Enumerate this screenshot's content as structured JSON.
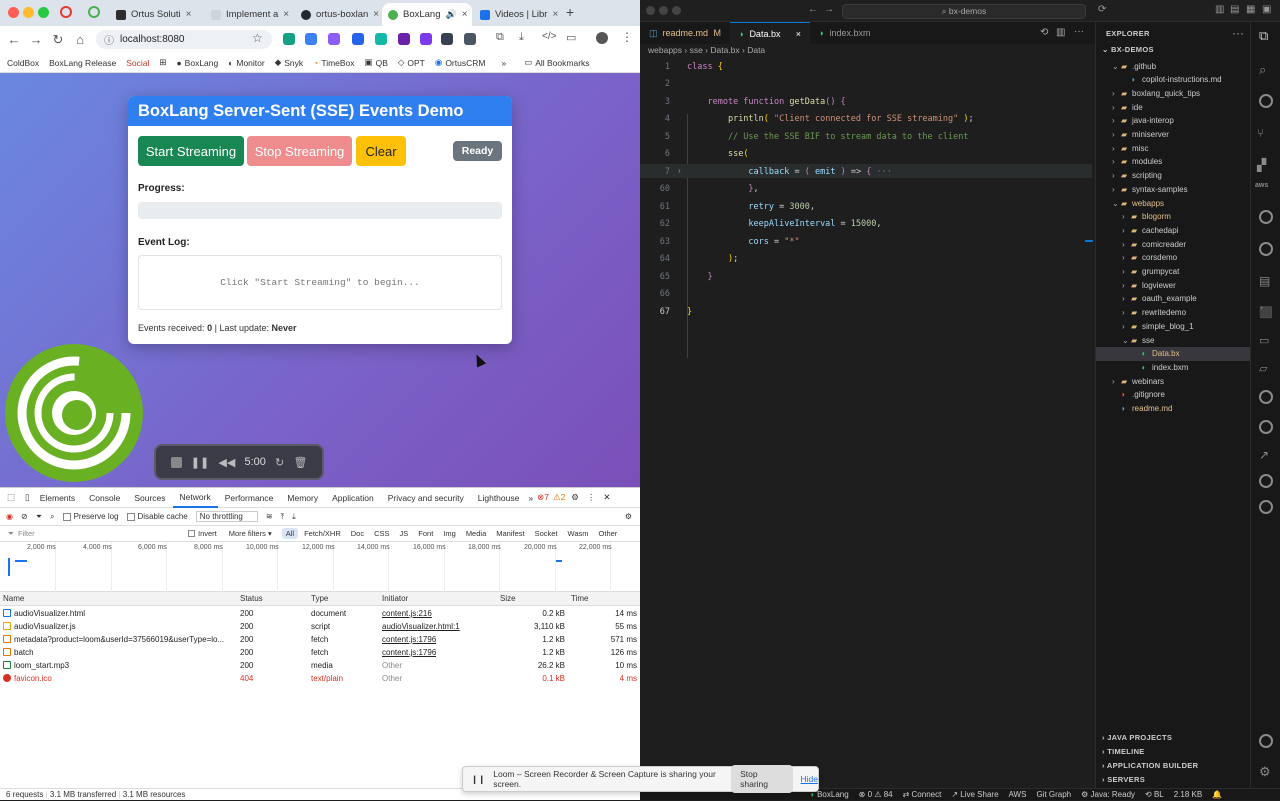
{
  "browser": {
    "tabs": [
      {
        "title": "Ortus Soluti",
        "color": "#2d2d2d"
      },
      {
        "title": "Implement a",
        "color": "#e8eaed"
      },
      {
        "title": "ortus-boxlan",
        "color": "#24292f"
      },
      {
        "title": "BoxLang",
        "color": "#4caf50"
      },
      {
        "title": "Videos | Libr",
        "color": "#1a73e8"
      }
    ],
    "url": "localhost:8080",
    "bookmarks": [
      "ColdBox",
      "BoxLang Release",
      "Social",
      "BoxLang",
      "Monitor",
      "Snyk",
      "TimeBox",
      "QB",
      "OPT",
      "OrtusCRM",
      "All Bookmarks"
    ]
  },
  "demo": {
    "title": "BoxLang Server-Sent (SSE) Events Demo",
    "start_label": "Start Streaming",
    "stop_label": "Stop Streaming",
    "clear_label": "Clear",
    "status": "Ready",
    "progress_label": "Progress:",
    "progress_value": 0,
    "event_log_label": "Event Log:",
    "log_placeholder": "Click \"Start Streaming\" to begin...",
    "events_received_label": "Events received:",
    "events_received": "0",
    "last_update_label": "Last update:",
    "last_update": "Never",
    "colors": {
      "header": "#2f7ff0",
      "start": "#198754",
      "stop": "#ee8c8e",
      "clear": "#ffc107",
      "status": "#6c757d"
    }
  },
  "loom": {
    "time": "5:00",
    "banner_text": "Loom – Screen Recorder & Screen Capture is sharing your screen.",
    "stop_label": "Stop sharing",
    "hide_label": "Hide"
  },
  "devtools": {
    "tabs": [
      "Elements",
      "Console",
      "Sources",
      "Network",
      "Performance",
      "Memory",
      "Application",
      "Privacy and security",
      "Lighthouse"
    ],
    "active_tab": "Network",
    "error_count": "7",
    "warning_count": "2",
    "preserve_log": "Preserve log",
    "disable_cache": "Disable cache",
    "throttling": "No throttling",
    "filter_placeholder": "Filter",
    "invert": "Invert",
    "more_filters": "More filters",
    "filter_types": [
      "All",
      "Fetch/XHR",
      "Doc",
      "CSS",
      "JS",
      "Font",
      "Img",
      "Media",
      "Manifest",
      "Socket",
      "Wasm",
      "Other"
    ],
    "timeline_ticks": [
      "2,000 ms",
      "4,000 ms",
      "6,000 ms",
      "8,000 ms",
      "10,000 ms",
      "12,000 ms",
      "14,000 ms",
      "16,000 ms",
      "18,000 ms",
      "20,000 ms",
      "22,000 ms"
    ],
    "columns": [
      "Name",
      "Status",
      "Type",
      "Initiator",
      "Size",
      "Time"
    ],
    "requests": [
      {
        "name": "audioVisualizer.html",
        "status": "200",
        "type": "document",
        "initiator": "content.js:216",
        "size": "0.2 kB",
        "time": "14 ms"
      },
      {
        "name": "audioVisualizer.js",
        "status": "200",
        "type": "script",
        "initiator": "audioVisualizer.html:1",
        "size": "3,110 kB",
        "time": "55 ms"
      },
      {
        "name": "metadata?product=loom&userId=37566019&userType=lo...",
        "status": "200",
        "type": "fetch",
        "initiator": "content.js:1796",
        "size": "1.2 kB",
        "time": "571 ms"
      },
      {
        "name": "batch",
        "status": "200",
        "type": "fetch",
        "initiator": "content.js:1796",
        "size": "1.2 kB",
        "time": "126 ms"
      },
      {
        "name": "loom_start.mp3",
        "status": "200",
        "type": "media",
        "initiator": "Other",
        "size": "26.2 kB",
        "time": "10 ms"
      },
      {
        "name": "favicon.ico",
        "status": "404",
        "type": "text/plain",
        "initiator": "Other",
        "size": "0.1 kB",
        "time": "4 ms"
      }
    ],
    "summary": {
      "requests": "6 requests",
      "transferred": "3.1 MB transferred",
      "resources": "3.1 MB resources"
    }
  },
  "vscode": {
    "search": "bx-demos",
    "tabs": [
      "readme.md",
      "Data.bx",
      "index.bxm"
    ],
    "breadcrumb": "webapps  ›  sse  ›  Data.bx  ›  Data",
    "code_lines": [
      {
        "n": "1",
        "text": "class {"
      },
      {
        "n": "2",
        "text": ""
      },
      {
        "n": "3",
        "text": "    remote function getData() {"
      },
      {
        "n": "4",
        "text": "        println( \"Client connected for SSE streaming\" );"
      },
      {
        "n": "5",
        "text": "        // Use the SSE BIF to stream data to the client"
      },
      {
        "n": "6",
        "text": "        sse("
      },
      {
        "n": "7",
        "text": "            callback = ( emit ) => { ···"
      },
      {
        "n": "60",
        "text": "            },"
      },
      {
        "n": "61",
        "text": "            retry = 3000,"
      },
      {
        "n": "62",
        "text": "            keepAliveInterval = 15000,"
      },
      {
        "n": "63",
        "text": "            cors = \"*\""
      },
      {
        "n": "64",
        "text": "        );"
      },
      {
        "n": "65",
        "text": "    }"
      },
      {
        "n": "66",
        "text": ""
      },
      {
        "n": "67",
        "text": "}"
      }
    ],
    "explorer": {
      "title": "EXPLORER",
      "root": "BX-DEMOS",
      "items": [
        {
          "label": ".github",
          "type": "folder-open",
          "depth": 1
        },
        {
          "label": "copilot-instructions.md",
          "type": "file",
          "depth": 2
        },
        {
          "label": "boxlang_quick_tips",
          "type": "folder",
          "depth": 1
        },
        {
          "label": "ide",
          "type": "folder",
          "depth": 1
        },
        {
          "label": "java-interop",
          "type": "folder",
          "depth": 1
        },
        {
          "label": "miniserver",
          "type": "folder",
          "depth": 1
        },
        {
          "label": "misc",
          "type": "folder",
          "depth": 1
        },
        {
          "label": "modules",
          "type": "folder",
          "depth": 1
        },
        {
          "label": "scripting",
          "type": "folder",
          "depth": 1
        },
        {
          "label": "syntax-samples",
          "type": "folder",
          "depth": 1
        },
        {
          "label": "webapps",
          "type": "folder-open",
          "depth": 1
        },
        {
          "label": "blogorm",
          "type": "folder",
          "depth": 2
        },
        {
          "label": "cachedapi",
          "type": "folder",
          "depth": 2
        },
        {
          "label": "comicreader",
          "type": "folder",
          "depth": 2
        },
        {
          "label": "corsdemo",
          "type": "folder",
          "depth": 2
        },
        {
          "label": "grumpycat",
          "type": "folder",
          "depth": 2
        },
        {
          "label": "logviewer",
          "type": "folder",
          "depth": 2
        },
        {
          "label": "oauth_example",
          "type": "folder",
          "depth": 2
        },
        {
          "label": "rewritedemo",
          "type": "folder",
          "depth": 2
        },
        {
          "label": "simple_blog_1",
          "type": "folder",
          "depth": 2
        },
        {
          "label": "sse",
          "type": "folder-open",
          "depth": 2
        },
        {
          "label": "Data.bx",
          "type": "file",
          "depth": 3
        },
        {
          "label": "index.bxm",
          "type": "file",
          "depth": 3
        },
        {
          "label": "webinars",
          "type": "folder",
          "depth": 1
        },
        {
          "label": ".gitignore",
          "type": "file",
          "depth": 1
        },
        {
          "label": "readme.md",
          "type": "file",
          "depth": 1
        }
      ],
      "sections": [
        "JAVA PROJECTS",
        "TIMELINE",
        "APPLICATION BUILDER",
        "SERVERS"
      ]
    },
    "status": {
      "branch": "BoxLang",
      "problems": "0",
      "warnings": "84",
      "connect": "Connect",
      "live_share": "Live Share",
      "aws": "AWS",
      "git_graph": "Git Graph",
      "java": "Java: Ready",
      "bl": "BL",
      "size": "2.18 KB"
    }
  }
}
